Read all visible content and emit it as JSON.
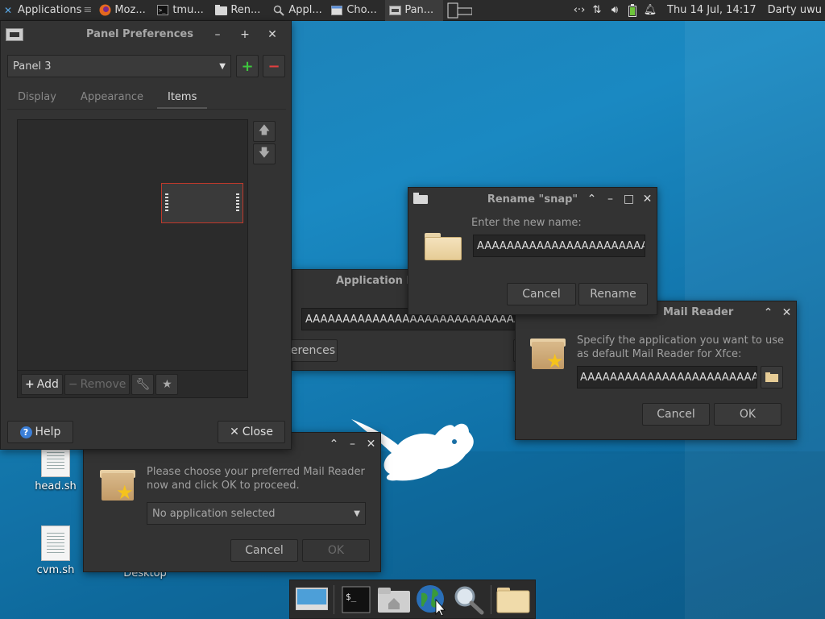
{
  "top_panel": {
    "applications_label": "Applications",
    "tasks": [
      {
        "label": "Moz...",
        "icon": "firefox-icon"
      },
      {
        "label": "tmu...",
        "icon": "terminal-icon"
      },
      {
        "label": "Ren...",
        "icon": "folder-icon"
      },
      {
        "label": "Appl...",
        "icon": "search-icon"
      },
      {
        "label": "Cho...",
        "icon": "window-icon"
      },
      {
        "label": "Pan...",
        "icon": "panel-icon"
      }
    ],
    "clock": "Thu 14 Jul, 14:17",
    "user": "Darty uwu"
  },
  "panel_prefs": {
    "title": "Panel Preferences",
    "panel_select": "Panel 3",
    "tabs": [
      "Display",
      "Appearance",
      "Items"
    ],
    "active_tab": "Items",
    "add_label": "Add",
    "remove_label": "Remove",
    "help_label": "Help",
    "close_label": "Close"
  },
  "app_finder": {
    "title": "Application F",
    "entry_value": "AAAAAAAAAAAAAAAAAAAAAAAAAAAAAA",
    "preferences_label": "references"
  },
  "rename": {
    "title": "Rename \"snap\"",
    "prompt": "Enter the new name:",
    "value": "AAAAAAAAAAAAAAAAAAAAAAA",
    "cancel_label": "Cancel",
    "rename_label": "Rename"
  },
  "mail_reader_specify": {
    "title": "Mail Reader",
    "text": "Specify the application you want to use as default Mail Reader for Xfce:",
    "value": "AAAAAAAAAAAAAAAAAAAAAAAAAA",
    "cancel_label": "Cancel",
    "ok_label": "OK"
  },
  "mail_reader_choose": {
    "text": "Please choose your preferred Mail Reader now and click OK to proceed.",
    "select_value": "No application selected",
    "cancel_label": "Cancel",
    "ok_label": "OK"
  },
  "desktop": {
    "icons": [
      {
        "label": "head.sh"
      },
      {
        "label": "cvm.sh"
      },
      {
        "label": "Desktop"
      }
    ]
  },
  "colors": {
    "window_bg": "#333333",
    "panel_bg": "#2b2b2b",
    "add_green": "#3ec63e",
    "remove_red": "#e04040",
    "highlight_red": "#c0392b",
    "help_blue": "#3b7ed6"
  }
}
